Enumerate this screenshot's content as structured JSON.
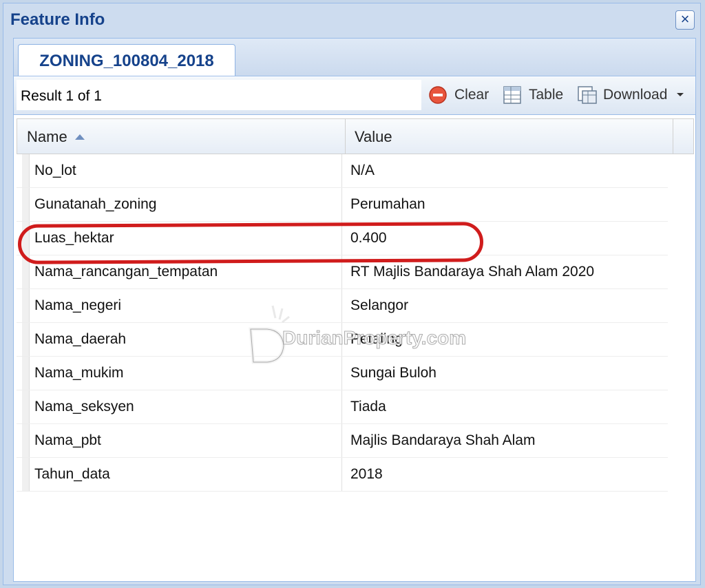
{
  "window": {
    "title": "Feature Info"
  },
  "tab": {
    "label": "ZONING_100804_2018"
  },
  "toolbar": {
    "result": "Result 1 of 1",
    "clear": "Clear",
    "table": "Table",
    "download": "Download"
  },
  "grid": {
    "columns": [
      "Name",
      "Value"
    ],
    "rows": [
      {
        "name": "No_lot",
        "value": "N/A"
      },
      {
        "name": "Gunatanah_zoning",
        "value": "Perumahan"
      },
      {
        "name": "Luas_hektar",
        "value": "0.400"
      },
      {
        "name": "Nama_rancangan_tempatan",
        "value": "RT Majlis Bandaraya Shah Alam 2020"
      },
      {
        "name": "Nama_negeri",
        "value": "Selangor"
      },
      {
        "name": "Nama_daerah",
        "value": "Petaling"
      },
      {
        "name": "Nama_mukim",
        "value": "Sungai Buloh"
      },
      {
        "name": "Nama_seksyen",
        "value": "Tiada"
      },
      {
        "name": "Nama_pbt",
        "value": "Majlis Bandaraya Shah Alam"
      },
      {
        "name": "Tahun_data",
        "value": "2018"
      }
    ]
  },
  "watermark": {
    "text": "DurianProperty.com"
  },
  "colors": {
    "header": "#15428b",
    "highlight": "#d01c1c",
    "border": "#99bbe8"
  }
}
